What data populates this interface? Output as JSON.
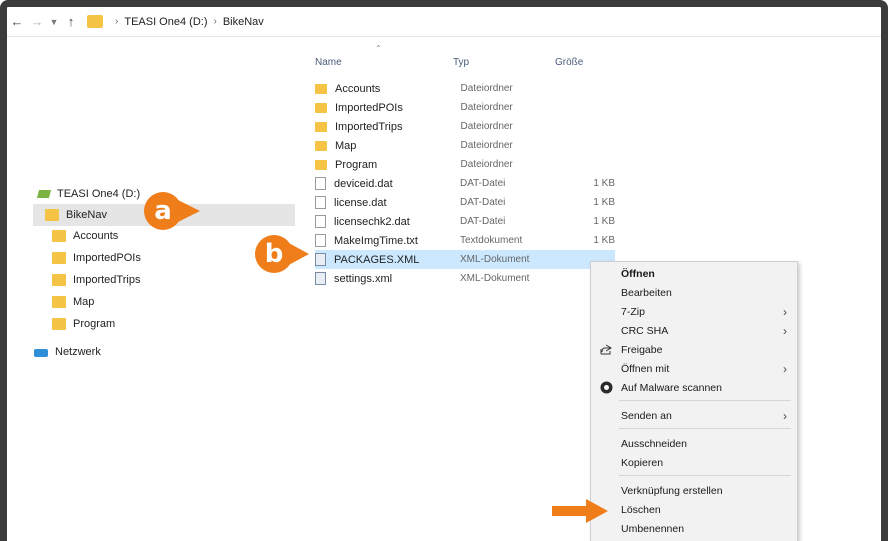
{
  "address": {
    "drive": "TEASI One4 (D:)",
    "folder": "BikeNav"
  },
  "nav": {
    "drive": "TEASI One4 (D:)",
    "items": [
      "BikeNav",
      "Accounts",
      "ImportedPOIs",
      "ImportedTrips",
      "Map",
      "Program"
    ],
    "network": "Netzwerk"
  },
  "badges": {
    "a": "a",
    "b": "b"
  },
  "columns": {
    "name": "Name",
    "type": "Typ",
    "size": "Größe"
  },
  "files": [
    {
      "name": "Accounts",
      "type": "Dateiordner",
      "size": "",
      "icon": "folder"
    },
    {
      "name": "ImportedPOIs",
      "type": "Dateiordner",
      "size": "",
      "icon": "folder"
    },
    {
      "name": "ImportedTrips",
      "type": "Dateiordner",
      "size": "",
      "icon": "folder"
    },
    {
      "name": "Map",
      "type": "Dateiordner",
      "size": "",
      "icon": "folder"
    },
    {
      "name": "Program",
      "type": "Dateiordner",
      "size": "",
      "icon": "folder"
    },
    {
      "name": "deviceid.dat",
      "type": "DAT-Datei",
      "size": "1 KB",
      "icon": "file"
    },
    {
      "name": "license.dat",
      "type": "DAT-Datei",
      "size": "1 KB",
      "icon": "file"
    },
    {
      "name": "licensechk2.dat",
      "type": "DAT-Datei",
      "size": "1 KB",
      "icon": "file"
    },
    {
      "name": "MakeImgTime.txt",
      "type": "Textdokument",
      "size": "1 KB",
      "icon": "file"
    },
    {
      "name": "PACKAGES.XML",
      "type": "XML-Dokument",
      "size": "",
      "icon": "xml"
    },
    {
      "name": "settings.xml",
      "type": "XML-Dokument",
      "size": "",
      "icon": "xml"
    }
  ],
  "context_menu": {
    "open": "Öffnen",
    "edit": "Bearbeiten",
    "zip": "7-Zip",
    "crc": "CRC SHA",
    "share": "Freigabe",
    "open_with": "Öffnen mit",
    "malware": "Auf Malware scannen",
    "send_to": "Senden an",
    "cut": "Ausschneiden",
    "copy": "Kopieren",
    "shortcut": "Verknüpfung erstellen",
    "delete": "Löschen",
    "rename": "Umbenennen"
  },
  "colors": {
    "accent": "#ef7d1a",
    "folder": "#f6c445",
    "selection": "#cce8ff"
  }
}
